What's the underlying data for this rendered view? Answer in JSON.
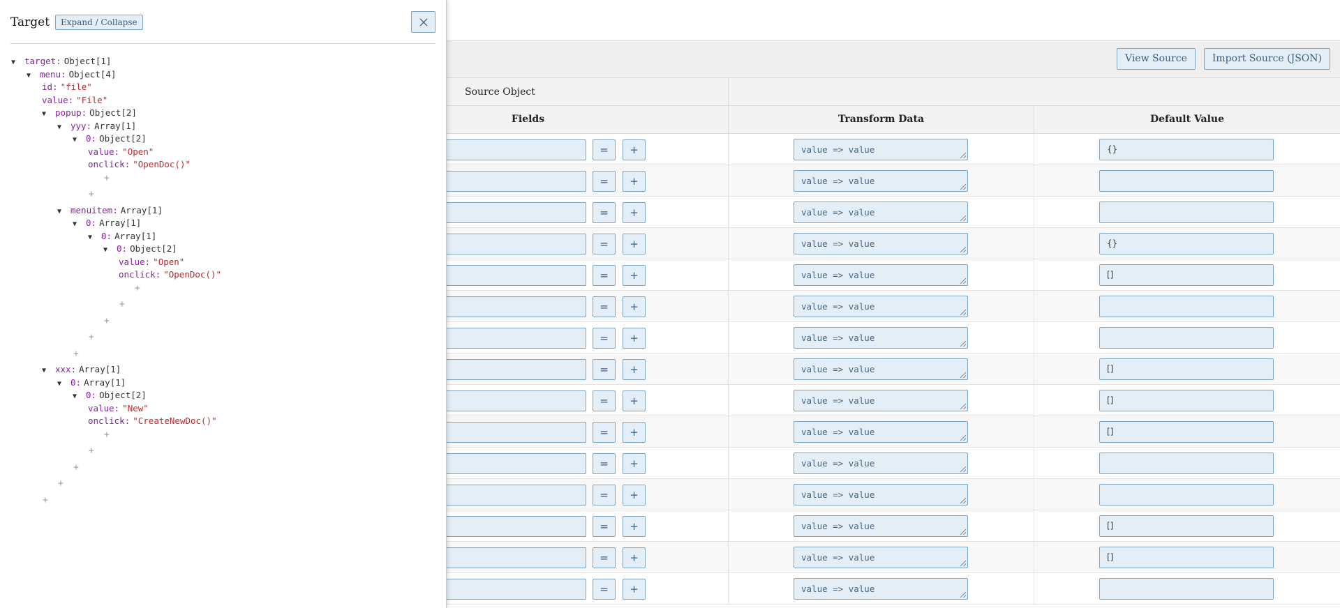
{
  "toolbar": {
    "view_source": "View Source",
    "import_source": "Import Source (JSON)"
  },
  "grid": {
    "group_header": "Source Object",
    "columns": {
      "fields": "Fields",
      "transform": "Transform Data",
      "default": "Default Value"
    },
    "eq_label": "=",
    "plus_label": "+",
    "rows": [
      {
        "transform": "value => value",
        "default": "{}"
      },
      {
        "transform": "value => value",
        "default": ""
      },
      {
        "transform": "value => value",
        "default": ""
      },
      {
        "transform": "value => value",
        "default": "{}"
      },
      {
        "transform": "value => value",
        "default": "[]"
      },
      {
        "transform": "value => value",
        "default": ""
      },
      {
        "transform": "value => value",
        "default": ""
      },
      {
        "transform": "value => value",
        "default": "[]"
      },
      {
        "transform": "value => value",
        "default": "[]"
      },
      {
        "transform": "value => value",
        "default": "[]"
      },
      {
        "transform": "value => value",
        "default": ""
      },
      {
        "transform": "value => value",
        "default": ""
      },
      {
        "transform": "value => value",
        "default": "[]"
      },
      {
        "transform": "value => value",
        "default": "[]"
      },
      {
        "transform": "value => value",
        "default": ""
      }
    ]
  },
  "panel": {
    "title": "Target",
    "expand_collapse": "Expand / Collapse",
    "tree": [
      {
        "depth": 0,
        "kind": "node",
        "key": "target",
        "type": "Object[1]"
      },
      {
        "depth": 1,
        "kind": "node",
        "key": "menu",
        "type": "Object[4]"
      },
      {
        "depth": 2,
        "kind": "leaf",
        "key": "id",
        "value": "\"file\""
      },
      {
        "depth": 2,
        "kind": "leaf",
        "key": "value",
        "value": "\"File\""
      },
      {
        "depth": 2,
        "kind": "node",
        "key": "popup",
        "type": "Object[2]"
      },
      {
        "depth": 3,
        "kind": "node",
        "key": "yyy",
        "type": "Array[1]"
      },
      {
        "depth": 4,
        "kind": "node",
        "key": "0",
        "type": "Object[2]"
      },
      {
        "depth": 5,
        "kind": "leaf",
        "key": "value",
        "value": "\"Open\""
      },
      {
        "depth": 5,
        "kind": "leaf",
        "key": "onclick",
        "value": "\"OpenDoc()\""
      },
      {
        "depth": 5,
        "kind": "plus"
      },
      {
        "depth": 4,
        "kind": "plus"
      },
      {
        "depth": 3,
        "kind": "node",
        "key": "menuitem",
        "type": "Array[1]"
      },
      {
        "depth": 4,
        "kind": "node",
        "key": "0",
        "type": "Array[1]"
      },
      {
        "depth": 5,
        "kind": "node",
        "key": "0",
        "type": "Array[1]"
      },
      {
        "depth": 6,
        "kind": "node",
        "key": "0",
        "type": "Object[2]"
      },
      {
        "depth": 7,
        "kind": "leaf",
        "key": "value",
        "value": "\"Open\""
      },
      {
        "depth": 7,
        "kind": "leaf",
        "key": "onclick",
        "value": "\"OpenDoc()\""
      },
      {
        "depth": 7,
        "kind": "plus"
      },
      {
        "depth": 6,
        "kind": "plus"
      },
      {
        "depth": 5,
        "kind": "plus"
      },
      {
        "depth": 4,
        "kind": "plus"
      },
      {
        "depth": 3,
        "kind": "plus"
      },
      {
        "depth": 2,
        "kind": "node",
        "key": "xxx",
        "type": "Array[1]"
      },
      {
        "depth": 3,
        "kind": "node",
        "key": "0",
        "type": "Array[1]"
      },
      {
        "depth": 4,
        "kind": "node",
        "key": "0",
        "type": "Object[2]"
      },
      {
        "depth": 5,
        "kind": "leaf",
        "key": "value",
        "value": "\"New\""
      },
      {
        "depth": 5,
        "kind": "leaf",
        "key": "onclick",
        "value": "\"CreateNewDoc()\""
      },
      {
        "depth": 5,
        "kind": "plus"
      },
      {
        "depth": 4,
        "kind": "plus"
      },
      {
        "depth": 3,
        "kind": "plus"
      },
      {
        "depth": 2,
        "kind": "plus"
      },
      {
        "depth": 1,
        "kind": "plus"
      }
    ]
  },
  "icons": {
    "tree_expanded": "triangle-down-icon",
    "close": "close-icon"
  },
  "colors": {
    "button_bg": "#e4eef6",
    "button_border": "#7ea4c4",
    "json_key": "#8b1ea6",
    "json_string": "#c2272d"
  }
}
